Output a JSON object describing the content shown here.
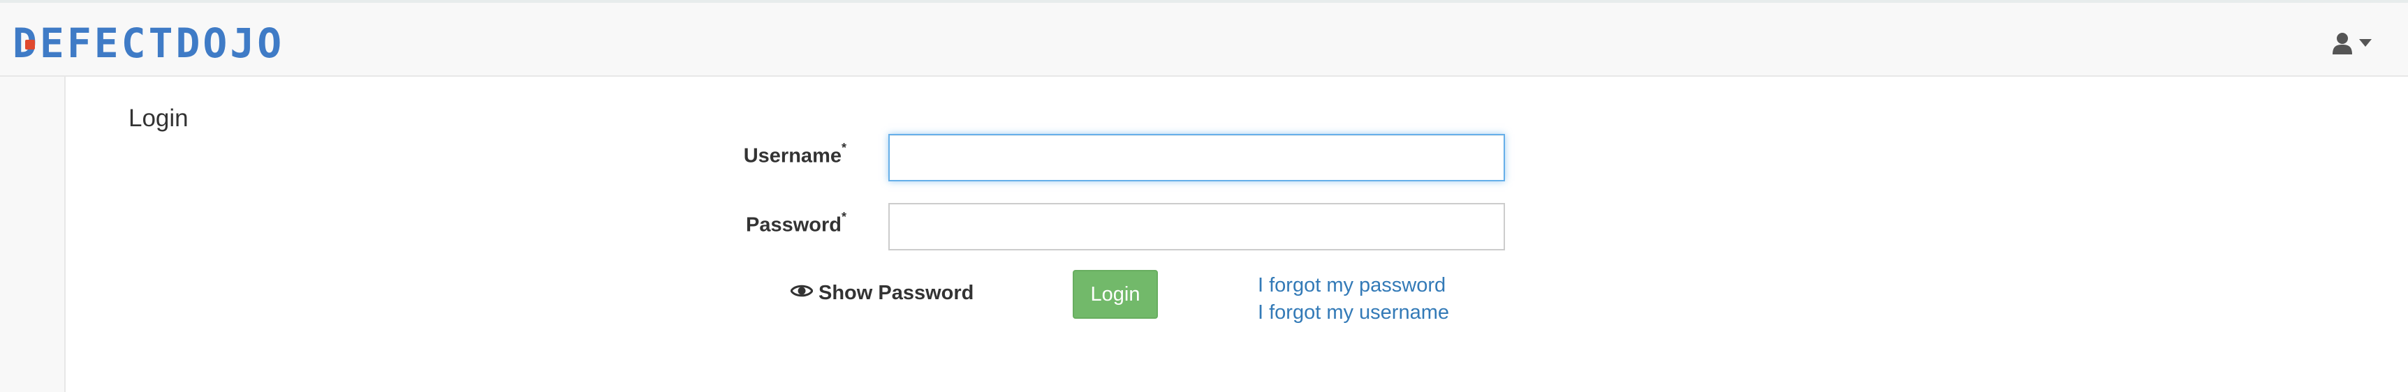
{
  "navbar": {
    "logo_text": "DEFECTDOJO",
    "user_icon": "user-icon",
    "dropdown_icon": "caret-down-icon"
  },
  "page": {
    "title": "Login"
  },
  "form": {
    "username_label": "Username",
    "username_required_mark": "*",
    "username_value": "",
    "password_label": "Password",
    "password_required_mark": "*",
    "password_value": "",
    "show_password_icon": "eye-icon",
    "show_password_label": "Show Password",
    "login_button_label": "Login",
    "forgot_password_link": "I forgot my password",
    "forgot_username_link": "I forgot my username"
  },
  "colors": {
    "brand": "#3f7bc6",
    "brand_accent": "#e0492f",
    "login_button": "#72b96a",
    "link": "#337ab7",
    "focus_border": "#66afe9"
  }
}
